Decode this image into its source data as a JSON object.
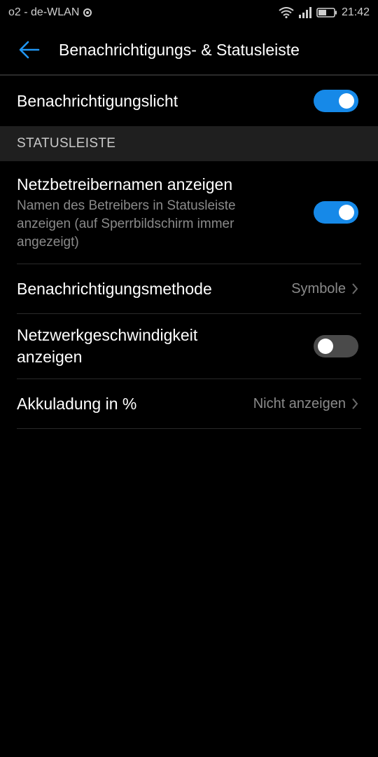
{
  "statusbar": {
    "carrier": "o2 - de-WLAN",
    "time": "21:42"
  },
  "header": {
    "title": "Benachrichtigungs- & Statusleiste"
  },
  "settings": {
    "notification_light": {
      "label": "Benachrichtigungslicht",
      "enabled": true
    },
    "section_title": "STATUSLEISTE",
    "carrier_name": {
      "label": "Netzbetreibernamen anzeigen",
      "subtitle": "Namen des Betreibers in Statusleiste anzeigen (auf Sperrbildschirm immer angezeigt)",
      "enabled": true
    },
    "notification_method": {
      "label": "Benachrichtigungsmethode",
      "value": "Symbole"
    },
    "network_speed": {
      "label": "Netzwerkgeschwindigkeit anzeigen",
      "enabled": false
    },
    "battery_percent": {
      "label": "Akkuladung in %",
      "value": "Nicht anzeigen"
    }
  },
  "colors": {
    "accent": "#1689e8",
    "background": "#000000",
    "section_bg": "#1f1f1f"
  }
}
